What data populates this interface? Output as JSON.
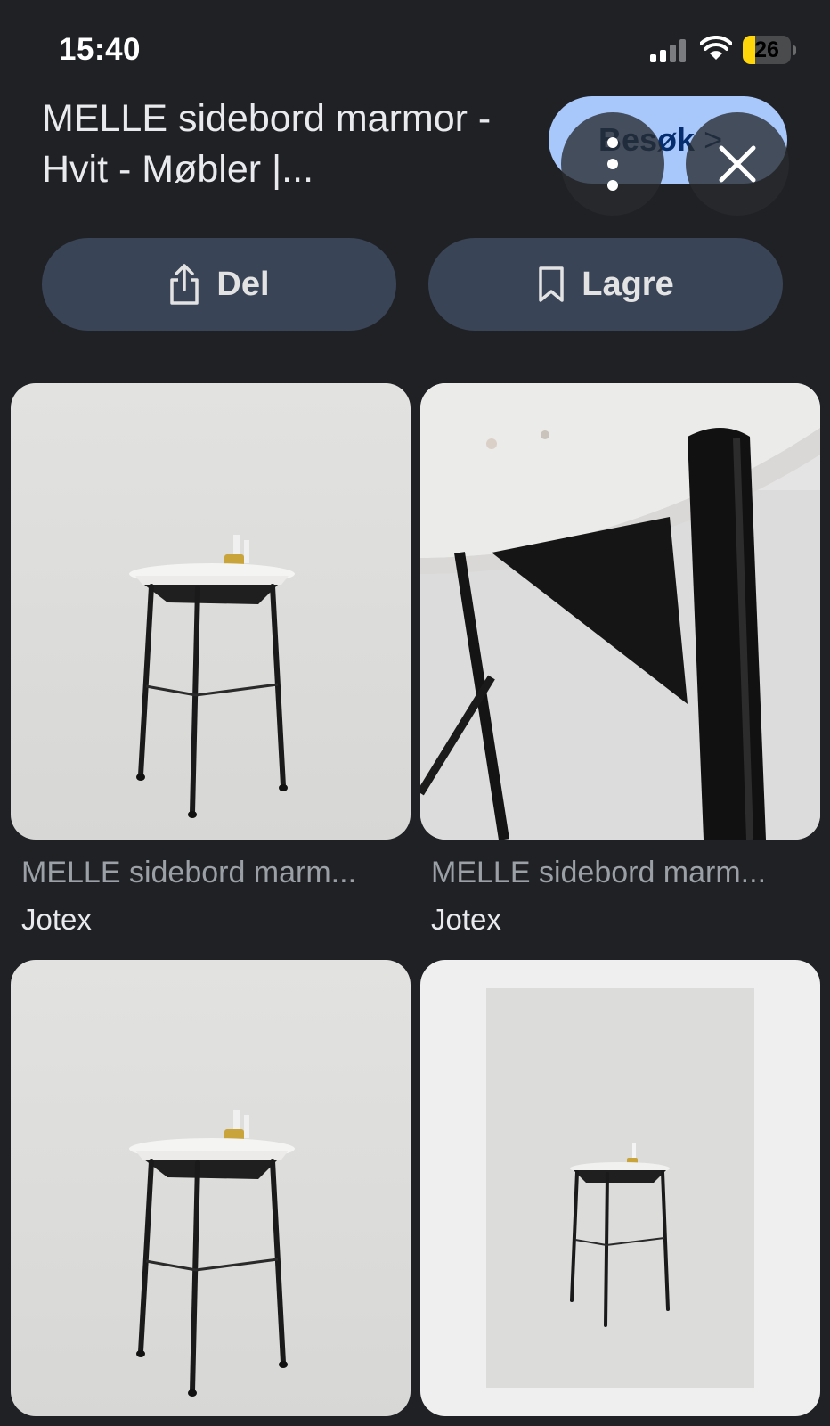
{
  "status_bar": {
    "time": "15:40",
    "battery": "26",
    "battery_level": 0.26
  },
  "header": {
    "title": "MELLE sidebord marmor - Hvit - Møbler |...",
    "visit_label": "Besøk",
    "visit_chevron": ">"
  },
  "actions": {
    "share_label": "Del",
    "save_label": "Lagre"
  },
  "results": [
    {
      "title": "MELLE sidebord marm...",
      "source": "Jotex"
    },
    {
      "title": "MELLE sidebord marm...",
      "source": "Jotex"
    },
    {
      "title": "",
      "source": ""
    },
    {
      "title": "",
      "source": ""
    }
  ],
  "icons": {
    "share": "share-icon",
    "save": "bookmark-icon",
    "more": "more-vertical-icon",
    "close": "close-icon"
  },
  "colors": {
    "background": "#202124",
    "visit_button": "#a8c7fa",
    "action_button": "#394457",
    "battery": "#ffd60a"
  }
}
